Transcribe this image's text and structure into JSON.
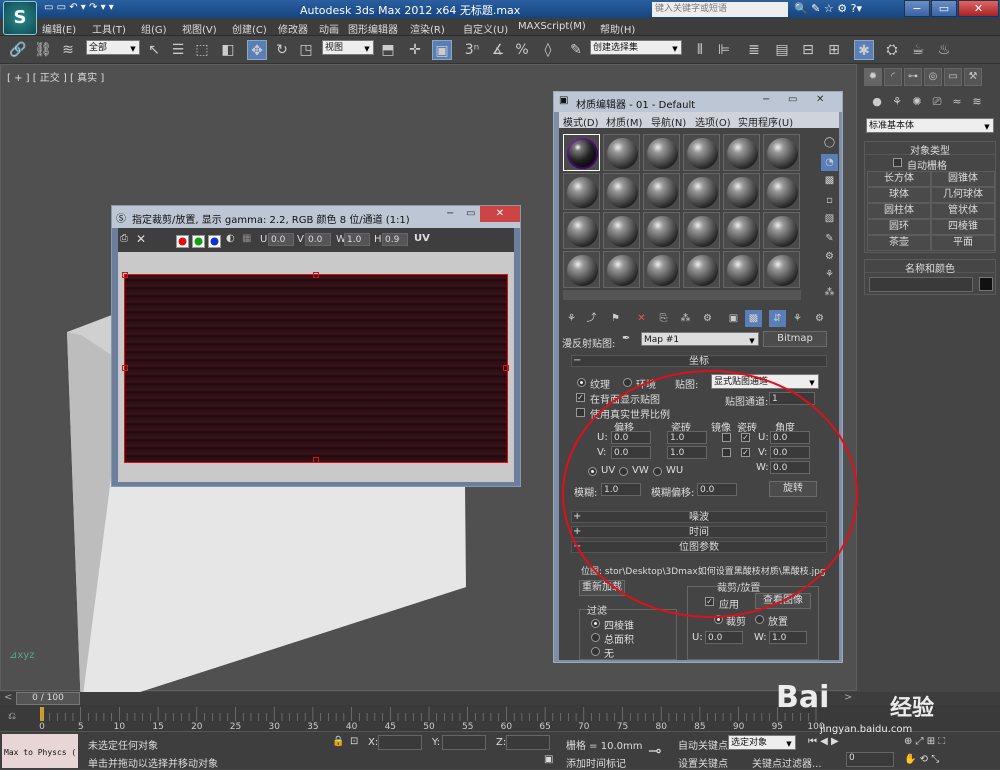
{
  "app": {
    "title": "Autodesk 3ds Max  2012 x64    无标题.max",
    "search_placeholder": "键入关键字或短语"
  },
  "menu": [
    "编辑(E)",
    "工具(T)",
    "组(G)",
    "视图(V)",
    "创建(C)",
    "修改器",
    "动画",
    "图形编辑器",
    "渲染(R)",
    "自定义(U)",
    "MAXScript(M)",
    "帮助(H)"
  ],
  "toolbar": {
    "selection_filter": "全部",
    "ref_coord": "视图",
    "named_selection": "创建选择集"
  },
  "viewport": {
    "label": "[ + ] [ 正交 ] [ 真实 ]"
  },
  "command_panel": {
    "category": "标准基本体",
    "object_type_header": "对象类型",
    "autogrid_label": "自动栅格",
    "buttons": [
      "长方体",
      "圆锥体",
      "球体",
      "几何球体",
      "圆柱体",
      "管状体",
      "圆环",
      "四棱锥",
      "茶壶",
      "平面"
    ],
    "name_color_header": "名称和颜色"
  },
  "crop_window": {
    "title": "指定裁剪/放置, 显示 gamma: 2.2, RGB 颜色 8 位/通道 (1:1)",
    "u_label": "U",
    "u_value": "0.0",
    "v_label": "V",
    "v_value": "0.0",
    "w_label": "W",
    "w_value": "1.0",
    "h_label": "H",
    "h_value": "0.9",
    "uv_label": "UV",
    "channel_colors": [
      "#e01010",
      "#10a010",
      "#1030d0"
    ]
  },
  "material_editor": {
    "title": "材质编辑器 - 01 - Default",
    "menu": [
      "模式(D)",
      "材质(M)",
      "导航(N)",
      "选项(O)",
      "实用程序(U)"
    ],
    "map_label": "漫反射贴图:",
    "map_name": "Map #1",
    "map_type": "Bitmap",
    "coords": {
      "header": "坐标",
      "texture_label": "纹理",
      "environ_label": "环境",
      "mapping_label": "贴图:",
      "mapping_value": "显式贴图通道",
      "show_map_back": "在背面显示贴图",
      "map_channel_label": "贴图通道:",
      "map_channel_value": "1",
      "real_world": "使用真实世界比例",
      "col_offset": "偏移",
      "col_tiling": "瓷砖",
      "col_mirror": "镜像",
      "col_tile": "瓷砖",
      "col_angle": "角度",
      "u_label": "U:",
      "v_label": "V:",
      "w_label": "W:",
      "u_offset": "0.0",
      "u_tiling": "1.0",
      "u_angle": "0.0",
      "v_offset": "0.0",
      "v_tiling": "1.0",
      "v_angle": "0.0",
      "w_angle": "0.0",
      "uv_label": "UV",
      "vw_label": "VW",
      "wu_label": "WU",
      "blur_label": "模糊:",
      "blur_value": "1.0",
      "blur_offset_label": "模糊偏移:",
      "blur_offset_value": "0.0",
      "rotate_button": "旋转"
    },
    "rollouts": [
      "噪波",
      "时间",
      "位图参数"
    ],
    "bitmap_path": "位图: stor\\Desktop\\3Dmax如何设置黑酸枝材质\\黑酸枝.jpg",
    "reload_button": "重新加载",
    "crop_header": "裁剪/放置",
    "apply_label": "应用",
    "view_image_button": "查看图像",
    "crop_label": "裁剪",
    "place_label": "放置",
    "filter_header": "过滤",
    "filter_options": [
      "四棱锥",
      "总面积",
      "无"
    ],
    "crop_u_label": "U:",
    "crop_u_value": "0.0",
    "crop_w_label": "W:",
    "crop_w_value": "1.0"
  },
  "timeline": {
    "frame": "0 / 100",
    "ticks": [
      "0",
      "5",
      "10",
      "15",
      "20",
      "25",
      "30",
      "35",
      "40",
      "45",
      "50",
      "55",
      "60",
      "65",
      "70",
      "75",
      "80",
      "85",
      "90",
      "95",
      "100"
    ]
  },
  "status": {
    "script_label": "Max to Physcs (",
    "line1": "未选定任何对象",
    "line2": "单击并拖动以选择并移动对象",
    "x_label": "X:",
    "y_label": "Y:",
    "z_label": "Z:",
    "grid": "栅格 = 10.0mm",
    "add_time_tag": "添加时间标记",
    "auto_key": "自动关键点",
    "set_key": "设置关键点",
    "selected_object": "选定对象",
    "key_filter": "关键点过滤器...",
    "frame_field": "0"
  },
  "watermark": {
    "brand": "Bai",
    "brand2": "经验",
    "url": "jingyan.baidu.com"
  }
}
